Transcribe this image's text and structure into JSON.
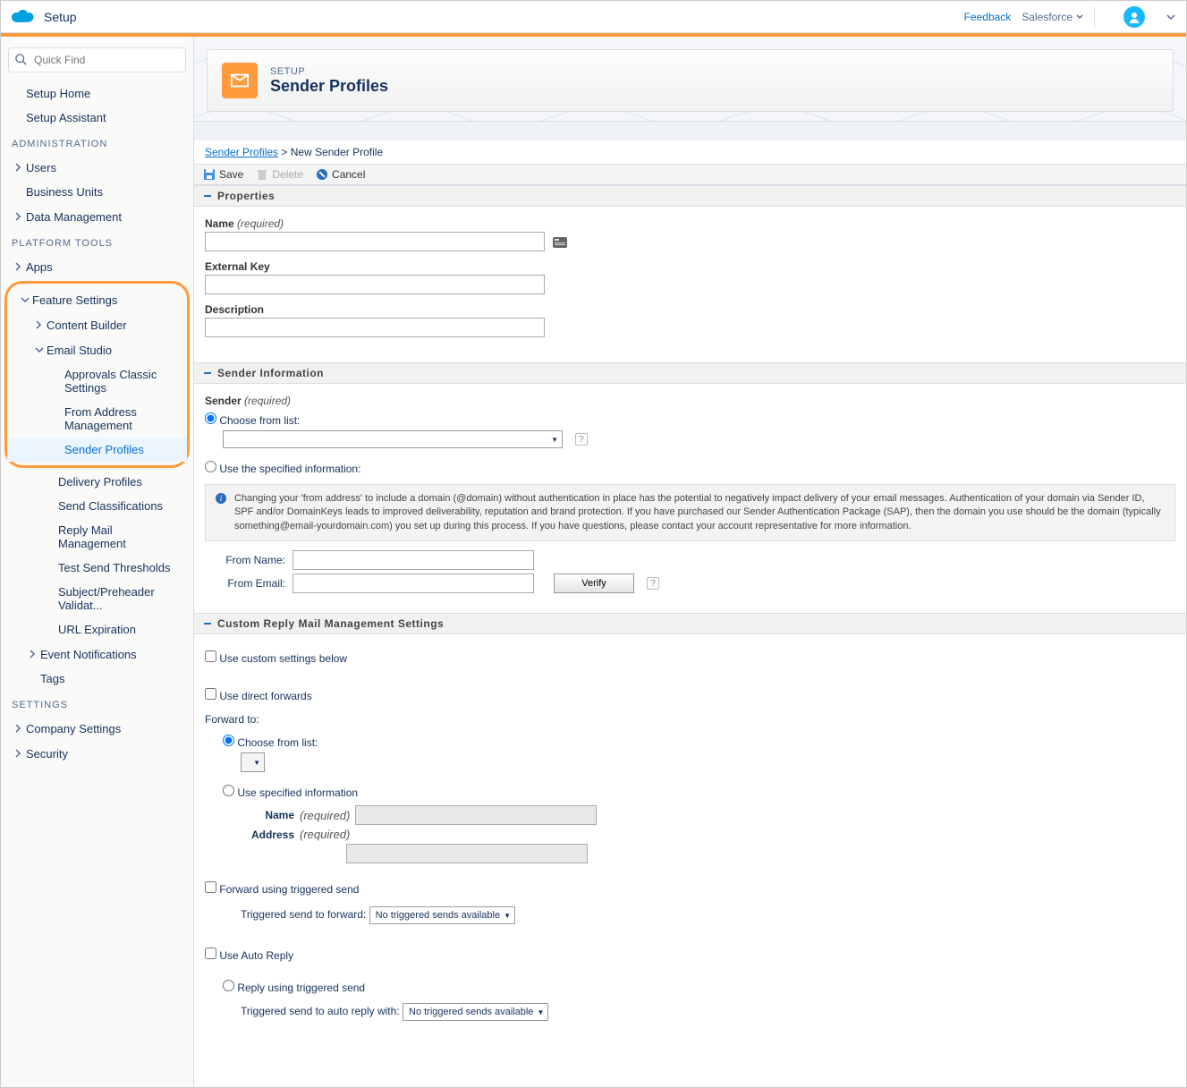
{
  "header": {
    "app_title": "Setup",
    "feedback": "Feedback",
    "org": "Salesforce"
  },
  "quick_find": {
    "placeholder": "Quick Find"
  },
  "nav": {
    "setup_home": "Setup Home",
    "setup_assistant": "Setup Assistant",
    "section_admin": "ADMINISTRATION",
    "users": "Users",
    "business_units": "Business Units",
    "data_management": "Data Management",
    "section_platform": "PLATFORM TOOLS",
    "apps": "Apps",
    "feature_settings": "Feature Settings",
    "content_builder": "Content Builder",
    "email_studio": "Email Studio",
    "approvals": "Approvals Classic Settings",
    "from_address": "From Address Management",
    "sender_profiles": "Sender Profiles",
    "delivery_profiles": "Delivery Profiles",
    "send_classifications": "Send Classifications",
    "reply_mail": "Reply Mail Management",
    "test_send": "Test Send Thresholds",
    "subject_preheader": "Subject/Preheader Validat...",
    "url_expiration": "URL Expiration",
    "event_notifications": "Event Notifications",
    "tags": "Tags",
    "section_settings": "SETTINGS",
    "company_settings": "Company Settings",
    "security": "Security"
  },
  "page": {
    "kicker": "SETUP",
    "title": "Sender Profiles"
  },
  "breadcrumb": {
    "parent": "Sender Profiles",
    "current": "New Sender Profile"
  },
  "toolbar": {
    "save": "Save",
    "delete": "Delete",
    "cancel": "Cancel"
  },
  "sections": {
    "properties": "Properties",
    "sender_info": "Sender Information",
    "reply_mail": "Custom Reply Mail Management Settings"
  },
  "form": {
    "name_label": "Name",
    "required": "(required)",
    "external_key": "External Key",
    "description": "Description",
    "sender_label": "Sender",
    "choose_list": "Choose from list:",
    "use_specified": "Use the specified information:",
    "info_text": "Changing your 'from address' to include a domain (@domain) without authentication in place has the potential to negatively impact delivery of your email messages. Authentication of your domain via Sender ID, SPF and/or DomainKeys leads to improved deliverability, reputation and brand protection. If you have purchased our Sender Authentication Package (SAP), then the domain you use should be the domain (typically something@email-yourdomain.com) you set up during this process. If you have questions, please contact your account representative for more information.",
    "from_name": "From Name:",
    "from_email": "From Email:",
    "verify": "Verify",
    "use_custom": "Use custom settings below",
    "use_direct": "Use direct forwards",
    "forward_to": "Forward to:",
    "use_specified_info": "Use specified information",
    "name_field": "Name",
    "address_field": "Address",
    "forward_triggered": "Forward using triggered send",
    "triggered_forward_label": "Triggered send to forward:",
    "use_auto_reply": "Use Auto Reply",
    "reply_triggered": "Reply using triggered send",
    "triggered_reply_label": "Triggered send to auto reply with:",
    "no_triggered": "No triggered sends available"
  }
}
